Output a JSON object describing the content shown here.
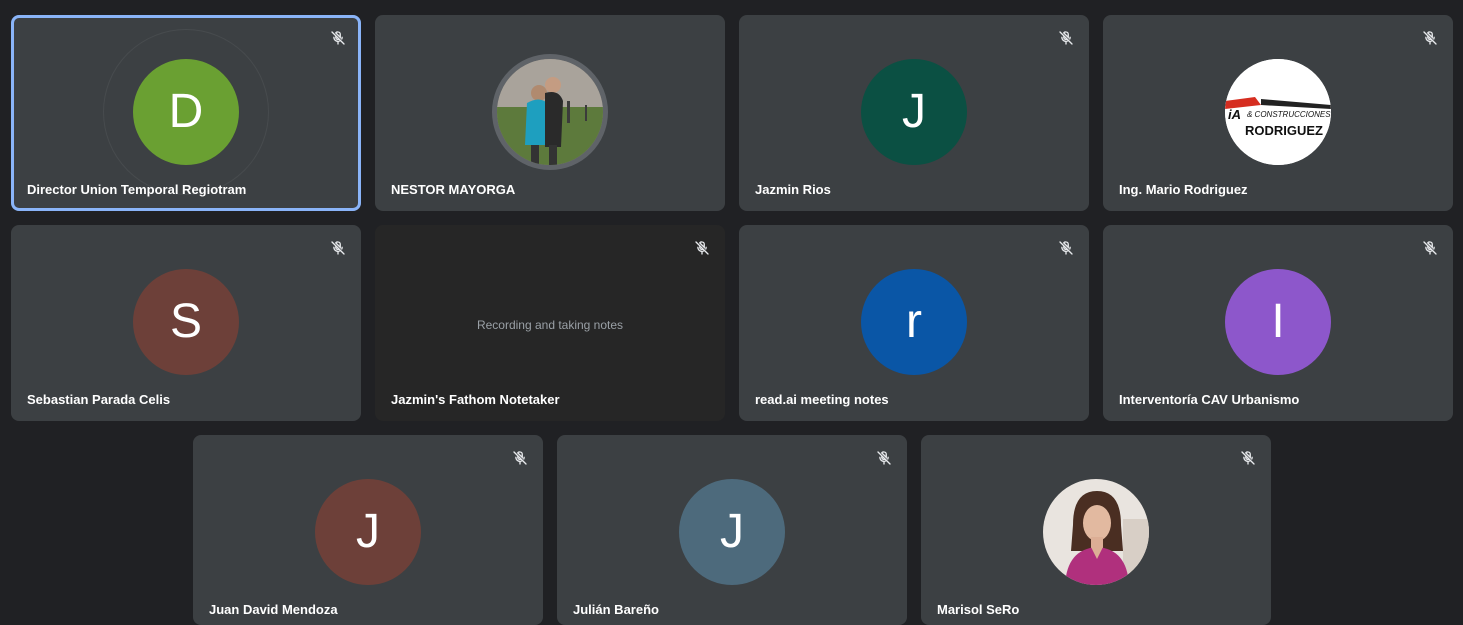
{
  "participants": [
    {
      "name": "Director Union Temporal Regiotram",
      "initial": "D",
      "color": "#6aa032",
      "muted": true,
      "active": true
    },
    {
      "name": "NESTOR MAYORGA",
      "avatar": "photo-couple-icon",
      "muted": false
    },
    {
      "name": "Jazmin Rios",
      "initial": "J",
      "color": "#0b5043",
      "muted": true
    },
    {
      "name": "Ing. Mario Rodriguez",
      "avatar": "construction-logo-icon",
      "logo_text_top": "& CONSTRUCCIONES",
      "logo_text_bottom": "RODRIGUEZ",
      "muted": true
    },
    {
      "name": "Sebastian Parada Celis",
      "initial": "S",
      "color": "#6d4039",
      "muted": true
    },
    {
      "name": "Jazmin's Fathom Notetaker",
      "status": "Recording and taking notes",
      "muted": true
    },
    {
      "name": "read.ai meeting notes",
      "initial": "r",
      "color": "#0a56a6",
      "muted": true
    },
    {
      "name": "Interventoría CAV Urbanismo",
      "initial": "I",
      "color": "#8d57cb",
      "muted": true
    },
    {
      "name": "Juan David Mendoza",
      "initial": "J",
      "color": "#6d4039",
      "muted": true
    },
    {
      "name": "Julián Bareño",
      "initial": "J",
      "color": "#4d6a7c",
      "muted": true
    },
    {
      "name": "Marisol SeRo",
      "avatar": "photo-woman-icon",
      "muted": true
    }
  ]
}
